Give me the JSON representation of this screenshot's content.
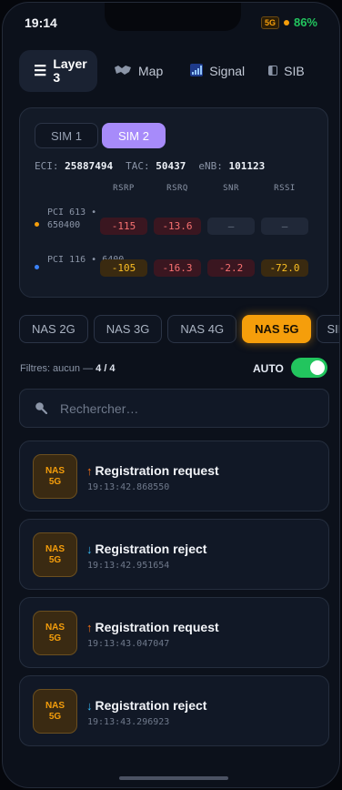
{
  "status": {
    "time": "19:14",
    "network": "5G",
    "battery": "86%"
  },
  "tabs": [
    {
      "label": "Layer 3",
      "icon": "menu-icon"
    },
    {
      "label": "Map",
      "icon": "map-icon"
    },
    {
      "label": "Signal",
      "icon": "signal-icon"
    },
    {
      "label": "SIB",
      "icon": "sib-icon"
    }
  ],
  "sim": {
    "buttons": [
      "SIM 1",
      "SIM 2"
    ],
    "selected": "SIM 2",
    "ids": {
      "eci_label": "ECI:",
      "eci": "25887494",
      "tac_label": "TAC:",
      "tac": "50437",
      "enb_label": "eNB:",
      "enb": "101123"
    },
    "columns": [
      "RSRP",
      "RSRQ",
      "SNR",
      "RSSI"
    ],
    "cells": [
      {
        "label": "PCI 613 • 650400",
        "dot_color": "#f59e0b",
        "rsrp": "-115",
        "rsrq": "-13.6",
        "snr": "–",
        "rssi": "–"
      },
      {
        "label": "PCI 116 • 6400",
        "dot_color": "#3b82f6",
        "rsrp": "-105",
        "rsrq": "-16.3",
        "snr": "-2.2",
        "rssi": "-72.0"
      }
    ]
  },
  "nas_tabs": [
    "NAS 2G",
    "NAS 3G",
    "NAS 4G",
    "NAS 5G",
    "SIP"
  ],
  "nas_selected": "NAS 5G",
  "filter": {
    "text": "Filtres: aucun — ",
    "count": "4 / 4",
    "auto_label": "AUTO",
    "auto_on": true
  },
  "search": {
    "placeholder": "Rechercher…",
    "value": ""
  },
  "messages": [
    {
      "badge_line1": "NAS",
      "badge_line2": "5G",
      "direction": "up",
      "arrow": "↑",
      "title": "Registration request",
      "time": "19:13:42.868550"
    },
    {
      "badge_line1": "NAS",
      "badge_line2": "5G",
      "direction": "down",
      "arrow": "↓",
      "title": "Registration reject",
      "time": "19:13:42.951654"
    },
    {
      "badge_line1": "NAS",
      "badge_line2": "5G",
      "direction": "up",
      "arrow": "↑",
      "title": "Registration request",
      "time": "19:13:43.047047"
    },
    {
      "badge_line1": "NAS",
      "badge_line2": "5G",
      "direction": "down",
      "arrow": "↓",
      "title": "Registration reject",
      "time": "19:13:43.296923"
    }
  ],
  "colors": {
    "accent_purple": "#a78bfa",
    "accent_orange": "#f59e0b",
    "toggle_green": "#22c55e"
  }
}
